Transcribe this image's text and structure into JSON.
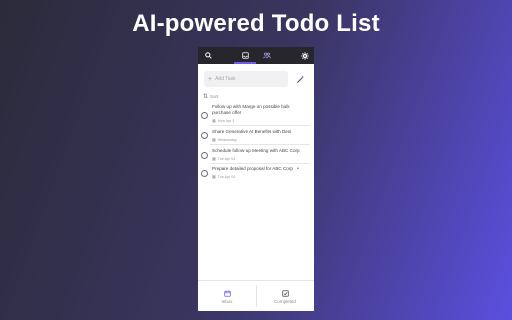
{
  "headline": "AI-powered Todo List",
  "app": {
    "topbar": {
      "icons": [
        "search-icon",
        "inbox-icon",
        "people-icon",
        "gear-icon"
      ],
      "active_tab": "inbox"
    },
    "add_task": {
      "placeholder": "Add Task"
    },
    "sort_label": "Sort",
    "tasks": [
      {
        "title": "Follow up with Marge on possible bulk purchase offer",
        "date": "Mon Apr 3"
      },
      {
        "title": "Share Generative AI Benefits with Desi",
        "date": "Wednesday"
      },
      {
        "title": "Schedule follow-up Meeting with ABC Corp",
        "date": "Tue Apr 04"
      },
      {
        "title": "Prepare detailed proposal for ABC Corp",
        "date": "Tue Apr 04"
      }
    ],
    "bottom_nav": {
      "inbox_label": "Inbox",
      "completed_label": "Completed"
    },
    "colors": {
      "accent": "#6c5ce7",
      "topbar": "#26262c"
    }
  }
}
